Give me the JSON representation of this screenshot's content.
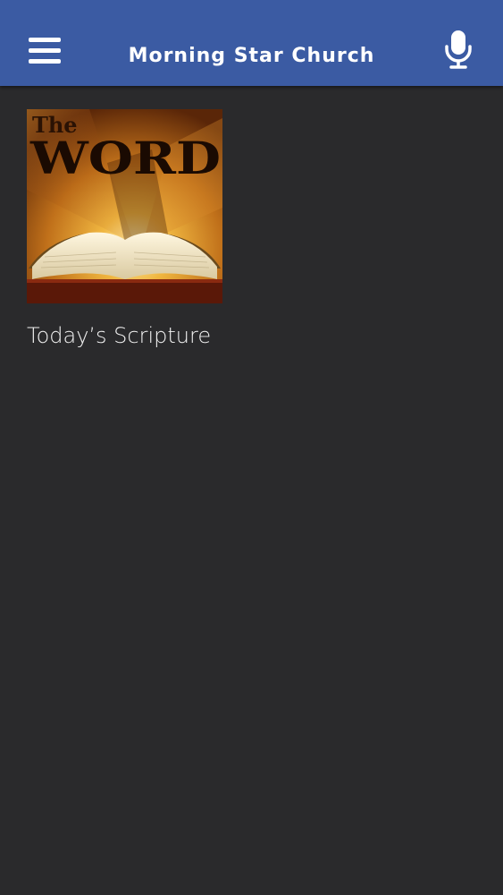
{
  "header": {
    "title": "Morning Star Church",
    "menu_icon": "hamburger-menu-icon",
    "voice_icon": "microphone-icon",
    "bar_color": "#3b5ba3"
  },
  "content": {
    "background_color": "#2a2a2c",
    "items": [
      {
        "label": "Today’s Scripture",
        "image": {
          "title_small": "The",
          "title_large": "WORD",
          "depicts": "open-bible"
        }
      }
    ]
  }
}
